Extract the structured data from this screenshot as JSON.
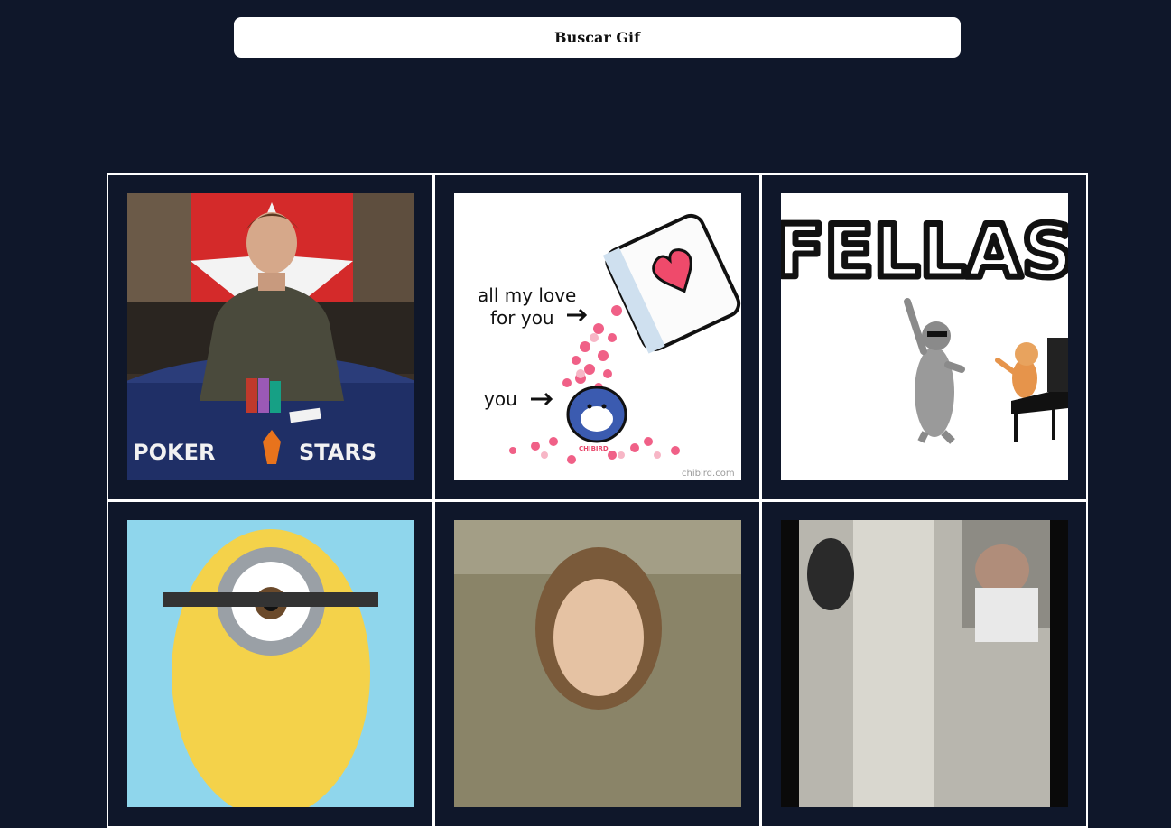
{
  "search": {
    "placeholder": "Buscar Gif"
  },
  "gifs": [
    {
      "name": "poker-player-gif"
    },
    {
      "name": "love-bucket-gif",
      "text_line1": "all my love",
      "text_line2": "for you",
      "text_you": "you",
      "badge": "CHIBIRD",
      "credit": "chibird.com"
    },
    {
      "name": "fellas-cats-gif",
      "title": "FELLAS"
    },
    {
      "name": "minion-gif"
    },
    {
      "name": "woman-gif"
    },
    {
      "name": "street-people-gif"
    }
  ],
  "poker": {
    "logo_left": "POKER",
    "logo_right": "STARS",
    "badge": "POKER STARS"
  }
}
